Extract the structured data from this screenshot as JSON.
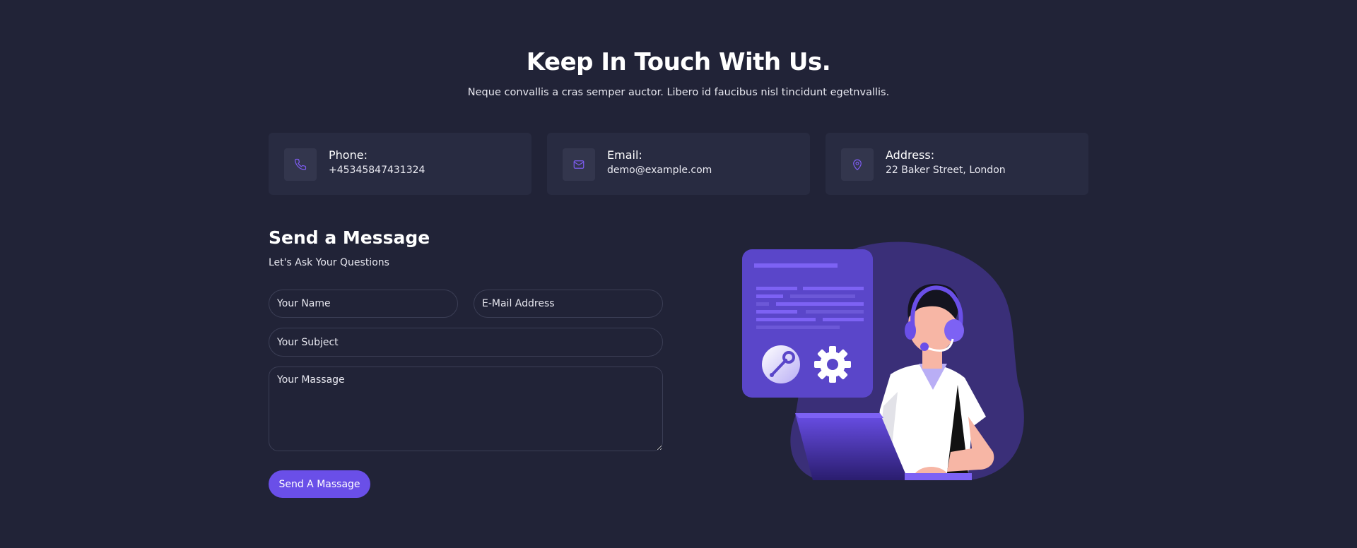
{
  "header": {
    "title": "Keep In Touch With Us.",
    "subtitle": "Neque convallis a cras semper auctor. Libero id faucibus nisl tincidunt egetnvallis."
  },
  "contact_cards": [
    {
      "icon": "phone-icon",
      "label": "Phone:",
      "value": "+45345847431324"
    },
    {
      "icon": "mail-icon",
      "label": "Email:",
      "value": "demo@example.com"
    },
    {
      "icon": "location-pin-icon",
      "label": "Address:",
      "value": "22 Baker Street, London"
    }
  ],
  "form": {
    "title": "Send a Message",
    "subtitle": "Let's Ask Your Questions",
    "name_placeholder": "Your Name",
    "email_placeholder": "E-Mail Address",
    "subject_placeholder": "Your Subject",
    "message_placeholder": "Your Massage",
    "submit_label": "Send A Massage"
  },
  "illustration": {
    "name": "customer-support-illustration"
  },
  "colors": {
    "background": "#212337",
    "card": "#282b41",
    "accent": "#6a4fe8",
    "icon_accent": "#7d5cf0"
  }
}
